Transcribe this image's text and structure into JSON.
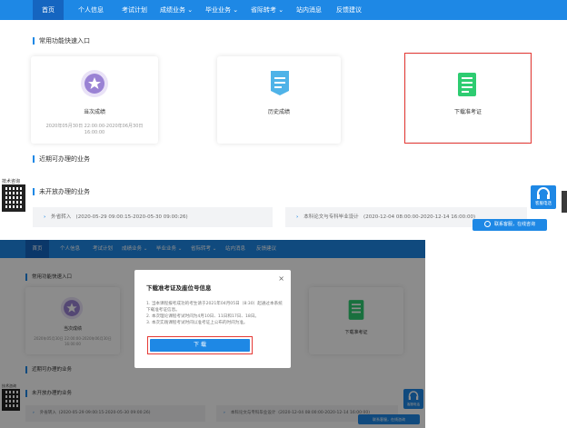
{
  "nav": {
    "items": [
      "首页",
      "个人信息",
      "考试计划",
      "成绩业务 ⌄",
      "毕业业务 ⌄",
      "省际转考 ⌄",
      "站内消息",
      "反馈建议"
    ]
  },
  "sections": {
    "quick": "常用功能快速入口",
    "recent": "近期可办理的业务",
    "notopen": "未开放办理的业务"
  },
  "cards": [
    {
      "label": "当次成绩",
      "sub": "2020年05月30日 22:00:00-2020年06月30日 16:00:00"
    },
    {
      "label": "历史成绩",
      "sub": ""
    },
    {
      "label": "下载准考证",
      "sub": ""
    }
  ],
  "rows": [
    {
      "name": "外省转入",
      "time": "(2020-05-29 09:00:15-2020-05-30 09:00:26)"
    },
    {
      "name": "本科论文与专科毕业设计",
      "time": "(2020-12-04 08:00:00-2020-12-14 16:00:00)"
    }
  ],
  "side": {
    "tech_label": "技术咨询",
    "hotline": "客服电话",
    "online": "联系客服，在线咨询"
  },
  "modal": {
    "title": "下载准考证及座位号信息",
    "close": "×",
    "lines": [
      "1. 当本课程报考成功的考生请于2021年04月05日（8:30）起通过本系统下载准考证信息。",
      "2. 本次理论课程考试时间为4月10日、11日和17日、18日。",
      "3. 本次实践课程考试时间以准考证上公布的时间为准。"
    ],
    "button": "下 载"
  },
  "colors": {
    "primary": "#1e88e5",
    "highlight": "#e53935"
  }
}
